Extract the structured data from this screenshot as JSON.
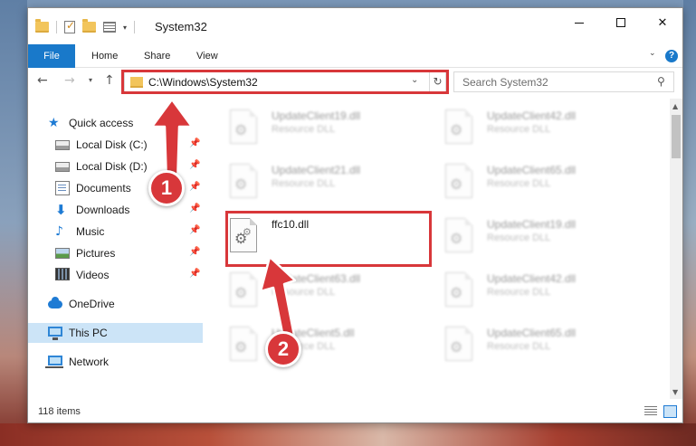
{
  "window": {
    "title": "System32",
    "controls": [
      "minimize",
      "maximize",
      "close"
    ]
  },
  "ribbon": {
    "tabs": [
      {
        "label": "File",
        "active": true
      },
      {
        "label": "Home"
      },
      {
        "label": "Share"
      },
      {
        "label": "View"
      }
    ]
  },
  "address_bar": {
    "path": "C:\\Windows\\System32",
    "refresh_icon": "refresh-icon"
  },
  "search": {
    "placeholder": "Search System32",
    "icon": "search-icon"
  },
  "sidebar": {
    "items": [
      {
        "label": "Quick access",
        "icon": "star-icon",
        "pinned": false,
        "level": 0
      },
      {
        "label": "Local Disk (C:)",
        "icon": "disk-icon",
        "pinned": true,
        "level": 1
      },
      {
        "label": "Local Disk (D:)",
        "icon": "disk-icon",
        "pinned": true,
        "level": 1
      },
      {
        "label": "Documents",
        "icon": "documents-icon",
        "pinned": true,
        "level": 1
      },
      {
        "label": "Downloads",
        "icon": "downloads-icon",
        "pinned": true,
        "level": 1
      },
      {
        "label": "Music",
        "icon": "music-icon",
        "pinned": true,
        "level": 1
      },
      {
        "label": "Pictures",
        "icon": "pictures-icon",
        "pinned": true,
        "level": 1
      },
      {
        "label": "Videos",
        "icon": "videos-icon",
        "pinned": true,
        "level": 1
      },
      {
        "label": "OneDrive",
        "icon": "cloud-icon",
        "pinned": false,
        "level": 0
      },
      {
        "label": "This PC",
        "icon": "computer-icon",
        "pinned": false,
        "level": 0,
        "selected": true
      },
      {
        "label": "Network",
        "icon": "network-icon",
        "pinned": false,
        "level": 0
      }
    ]
  },
  "files": [
    {
      "name": "UpdateClient19.dll",
      "type": "Resource DLL",
      "blurred": true
    },
    {
      "name": "UpdateClient42.dll",
      "type": "Resource DLL",
      "blurred": true
    },
    {
      "name": "UpdateClient21.dll",
      "type": "Resource DLL",
      "blurred": true
    },
    {
      "name": "UpdateClient65.dll",
      "type": "Resource DLL",
      "blurred": true
    },
    {
      "name": "ffc10.dll",
      "type": "",
      "blurred": false,
      "highlighted": true
    },
    {
      "name": "UpdateClient19.dll",
      "type": "Resource DLL",
      "blurred": true
    },
    {
      "name": "UpdateClient63.dll",
      "type": "Resource DLL",
      "blurred": true
    },
    {
      "name": "UpdateClient42.dll",
      "type": "Resource DLL",
      "blurred": true
    },
    {
      "name": "UpdateClient5.dll",
      "type": "Resource DLL",
      "blurred": true
    },
    {
      "name": "UpdateClient65.dll",
      "type": "Resource DLL",
      "blurred": true
    }
  ],
  "status": {
    "item_count": "118 items"
  },
  "annotations": {
    "step1": "1",
    "step2": "2",
    "color": "#d8373a"
  },
  "colors": {
    "accent": "#1979ca",
    "selection": "#cce4f7",
    "highlight_box": "#d8373a"
  }
}
